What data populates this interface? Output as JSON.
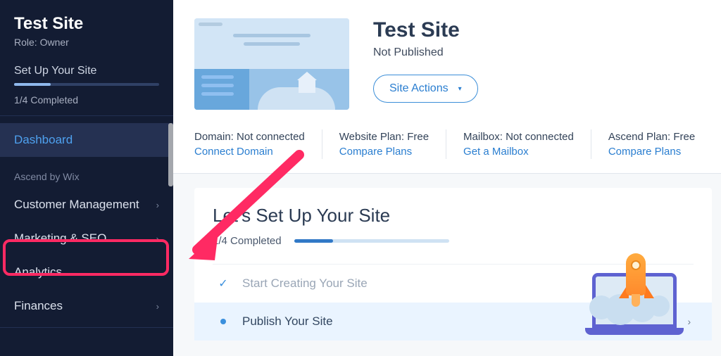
{
  "sidebar": {
    "site_name": "Test Site",
    "role_label": "Role: Owner",
    "setup_title": "Set Up Your Site",
    "completed": "1/4 Completed",
    "nav": {
      "dashboard": "Dashboard",
      "section_ascend": "Ascend by Wix",
      "customer_mgmt": "Customer Management",
      "marketing_seo": "Marketing & SEO",
      "analytics": "Analytics",
      "finances": "Finances"
    }
  },
  "main": {
    "site_title": "Test Site",
    "site_status": "Not Published",
    "site_actions": "Site Actions",
    "info": {
      "domain_label": "Domain: Not connected",
      "domain_link": "Connect Domain",
      "plan_label": "Website Plan: Free",
      "plan_link": "Compare Plans",
      "mailbox_label": "Mailbox: Not connected",
      "mailbox_link": "Get a Mailbox",
      "ascend_label": "Ascend Plan: Free",
      "ascend_link": "Compare Plans"
    },
    "setup": {
      "heading": "Let's Set Up Your Site",
      "completed": "1/4 Completed",
      "step1": "Start Creating Your Site",
      "step2": "Publish Your Site"
    }
  }
}
